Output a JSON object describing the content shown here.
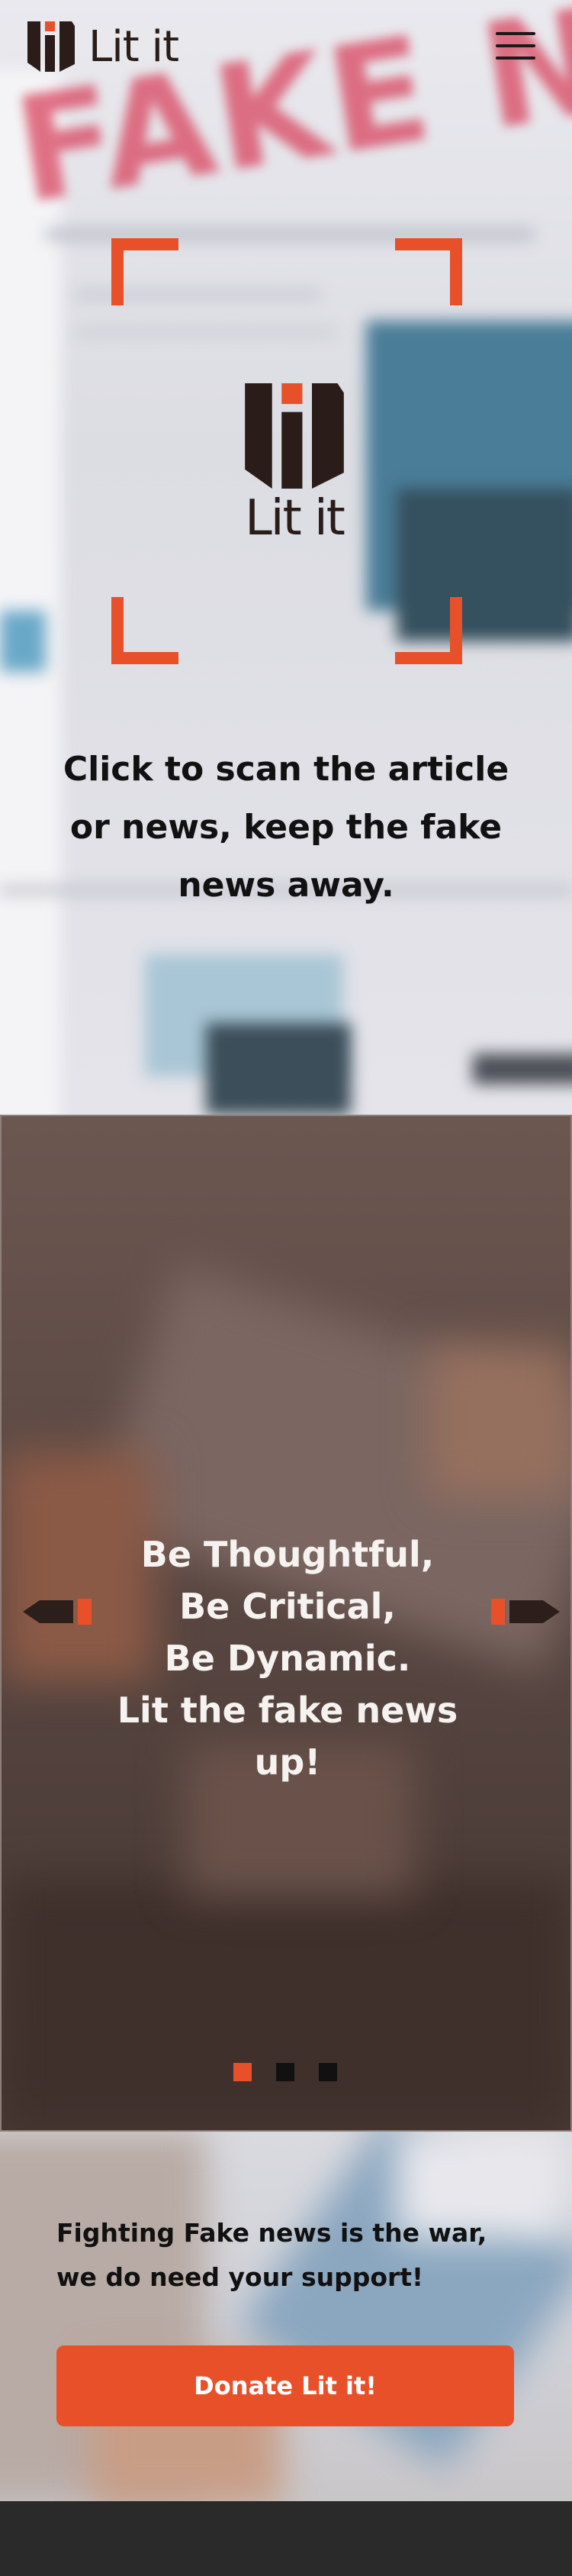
{
  "header": {
    "brand_name": "Lit it",
    "menu_icon": "hamburger-menu-icon",
    "logo_icon": "lit-it-logo-icon"
  },
  "hero": {
    "background_headline": "FAKE NEWS",
    "scan_prompt": "Click to scan the article or news, keep the fake news away.",
    "scan_frame_icon": "scan-corners-icon",
    "brand_name": "Lit it"
  },
  "slider": {
    "lines": [
      "Be Thoughtful,",
      "Be Critical,",
      "Be Dynamic.",
      "Lit the fake news",
      "up!"
    ],
    "prev_icon": "arrow-left-icon",
    "next_icon": "arrow-right-icon",
    "dots": [
      {
        "active": true
      },
      {
        "active": false
      },
      {
        "active": false
      }
    ]
  },
  "support": {
    "line1": "Fighting Fake news is the war,",
    "line2": "we do need your support!",
    "donate_label": "Donate Lit it!"
  },
  "colors": {
    "accent": "#e8502a",
    "logo_dark": "#2a1c18",
    "slider_bg": "#5d4a45",
    "footer_bg": "#2a2a2a"
  }
}
